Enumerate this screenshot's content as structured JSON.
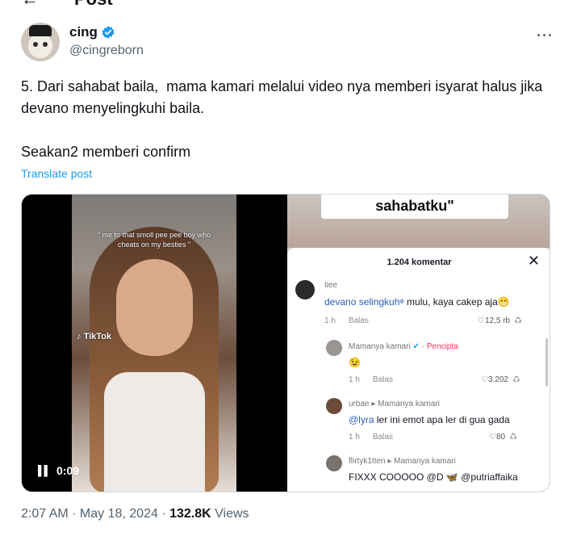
{
  "header": {
    "title": "Post",
    "back_icon": "arrow-left-icon"
  },
  "author": {
    "display_name": "cing",
    "handle": "@cingreborn",
    "verified_color": "#1d9bf0"
  },
  "tweet": {
    "paragraphs": [
      "5. Dari sahabat baila,  mama kamari melalui video nya memberi isyarat halus jika devano menyelingkuhi baila.",
      "Seakan2 memberi confirm"
    ],
    "translate_label": "Translate post"
  },
  "video": {
    "caption": "\" me to that smoll pee pee boy who cheats on my besties \"",
    "watermark": "TikTok",
    "time": "0:09"
  },
  "comments_panel": {
    "story_label": "sahabatku\"",
    "title": "1.204 komentar",
    "reply_label": "Balas",
    "comments": [
      {
        "user": "tiee",
        "mention": "devano selingkuh",
        "text": " mulu, kaya cakep aja😁",
        "age": "1 h",
        "likes": "12,5 rb"
      },
      {
        "user": "Mamanya kamari",
        "creator": "Pencipta",
        "mention": "",
        "text": "😉",
        "age": "1 h",
        "likes": "3.202"
      },
      {
        "user": "urbae ▸ Mamanya kamari",
        "mention": "@lyra",
        "text": " ler ini emot apa ler di gua gada",
        "age": "1 h",
        "likes": "80"
      },
      {
        "user": "flirtyk1tten ▸ Mamanya kamari",
        "mention": "",
        "text": "FIXXX COOOOO @D 🦋 @putriaffaika",
        "age": "",
        "likes": ""
      }
    ]
  },
  "footer": {
    "time": "2:07 AM",
    "separator": " · ",
    "date": "May 18, 2024",
    "views_count": "132.8K",
    "views_label": " Views"
  }
}
